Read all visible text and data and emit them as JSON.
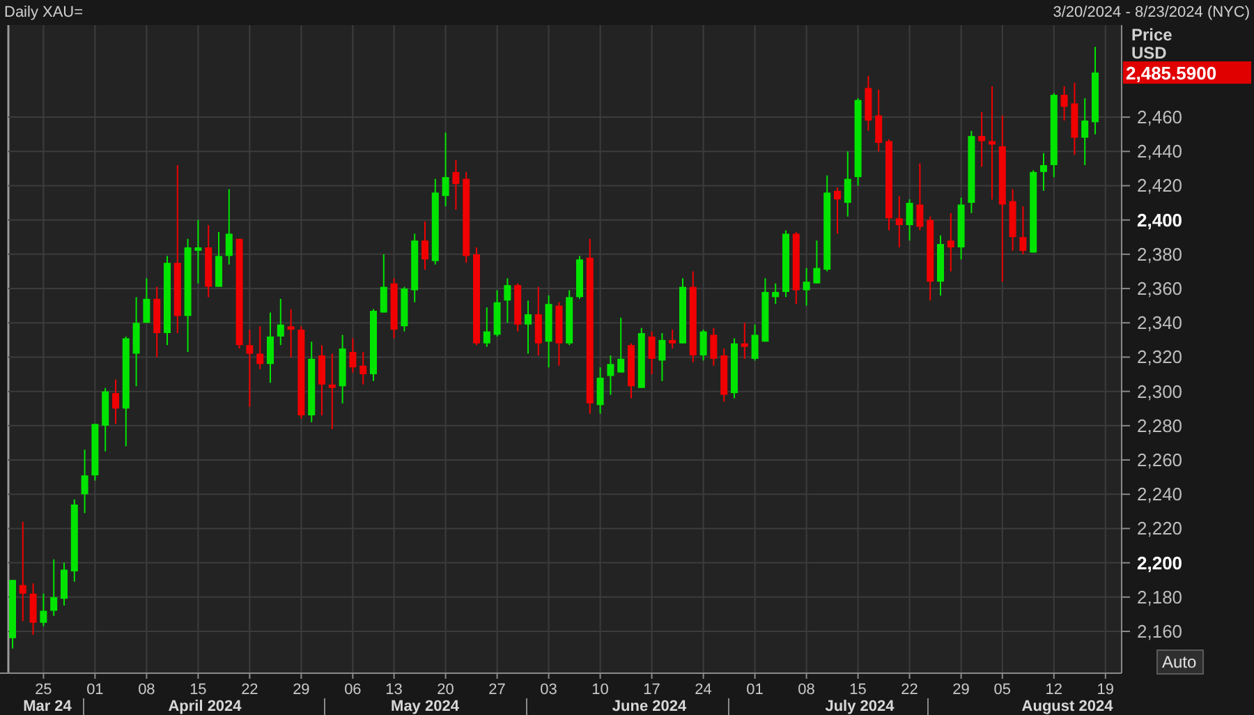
{
  "header": {
    "title": "Daily XAU=",
    "date_range": "3/20/2024 - 8/23/2024 (NYC)"
  },
  "price_axis": {
    "title": "Price",
    "currency": "USD",
    "last_price": "2,485.5900"
  },
  "scale_button": {
    "label": "Auto"
  },
  "chart": {
    "chart_data": {
      "type": "candlestick",
      "grid": true,
      "ylim": [
        2135.6,
        2513.7
      ],
      "categories": [
        null,
        null,
        null,
        "25",
        null,
        null,
        null,
        null,
        "01",
        null,
        null,
        null,
        null,
        "08",
        null,
        null,
        null,
        null,
        "15",
        null,
        null,
        null,
        null,
        "22",
        null,
        null,
        null,
        null,
        "29",
        null,
        null,
        null,
        null,
        "06",
        null,
        null,
        null,
        "13",
        null,
        null,
        null,
        null,
        "20",
        null,
        null,
        null,
        null,
        "27",
        null,
        null,
        null,
        null,
        "03",
        null,
        null,
        null,
        null,
        "10",
        null,
        null,
        null,
        null,
        "17",
        null,
        null,
        null,
        null,
        "24",
        null,
        null,
        null,
        null,
        "01",
        null,
        null,
        null,
        null,
        "08",
        null,
        null,
        null,
        null,
        "15",
        null,
        null,
        null,
        null,
        "22",
        null,
        null,
        null,
        null,
        "29",
        null,
        null,
        null,
        "05",
        null,
        null,
        null,
        null,
        "12",
        null,
        null,
        null,
        null,
        "19"
      ],
      "ohlc": [
        [
          2156,
          2190,
          2150,
          2190
        ],
        [
          2187,
          2224,
          2166,
          2182
        ],
        [
          2182,
          2188,
          2158,
          2165
        ],
        [
          2165,
          2182,
          2163,
          2172
        ],
        [
          2172,
          2202,
          2169,
          2180
        ],
        [
          2179,
          2200,
          2175,
          2196
        ],
        [
          2195,
          2237,
          2189,
          2234
        ],
        [
          2240,
          2266,
          2229,
          2251
        ],
        [
          2251,
          2281,
          2248,
          2281
        ],
        [
          2280,
          2302,
          2265,
          2300
        ],
        [
          2299,
          2307,
          2281,
          2290
        ],
        [
          2290,
          2332,
          2268,
          2331
        ],
        [
          2322,
          2355,
          2303,
          2340
        ],
        [
          2340,
          2366,
          2340,
          2354
        ],
        [
          2354,
          2361,
          2320,
          2334
        ],
        [
          2334,
          2379,
          2327,
          2375
        ],
        [
          2375,
          2432,
          2334,
          2344
        ],
        [
          2344,
          2389,
          2323,
          2384
        ],
        [
          2382,
          2400,
          2363,
          2384
        ],
        [
          2384,
          2397,
          2355,
          2361
        ],
        [
          2361,
          2393,
          2361,
          2379
        ],
        [
          2379,
          2418,
          2374,
          2392
        ],
        [
          2389,
          2389,
          2325,
          2327
        ],
        [
          2327,
          2336,
          2291,
          2322
        ],
        [
          2322,
          2338,
          2313,
          2316
        ],
        [
          2316,
          2346,
          2305,
          2332
        ],
        [
          2332,
          2354,
          2327,
          2339
        ],
        [
          2338,
          2348,
          2320,
          2336
        ],
        [
          2336,
          2338,
          2284,
          2286
        ],
        [
          2286,
          2329,
          2282,
          2319
        ],
        [
          2321,
          2327,
          2286,
          2304
        ],
        [
          2304,
          2322,
          2278,
          2302
        ],
        [
          2303,
          2333,
          2293,
          2325
        ],
        [
          2323,
          2331,
          2311,
          2314
        ],
        [
          2315,
          2323,
          2304,
          2310
        ],
        [
          2310,
          2348,
          2306,
          2347
        ],
        [
          2346,
          2380,
          2346,
          2361
        ],
        [
          2363,
          2366,
          2331,
          2336
        ],
        [
          2338,
          2361,
          2335,
          2360
        ],
        [
          2359,
          2392,
          2352,
          2388
        ],
        [
          2388,
          2399,
          2371,
          2377
        ],
        [
          2376,
          2424,
          2374,
          2416
        ],
        [
          2414,
          2451,
          2408,
          2425
        ],
        [
          2428,
          2435,
          2406,
          2421
        ],
        [
          2424,
          2428,
          2375,
          2379
        ],
        [
          2380,
          2384,
          2327,
          2328
        ],
        [
          2328,
          2349,
          2326,
          2335
        ],
        [
          2333,
          2359,
          2332,
          2352
        ],
        [
          2353,
          2366,
          2340,
          2362
        ],
        [
          2362,
          2363,
          2335,
          2339
        ],
        [
          2339,
          2353,
          2322,
          2345
        ],
        [
          2345,
          2361,
          2321,
          2328
        ],
        [
          2329,
          2356,
          2314,
          2351
        ],
        [
          2350,
          2352,
          2315,
          2328
        ],
        [
          2328,
          2359,
          2327,
          2355
        ],
        [
          2355,
          2379,
          2354,
          2377
        ],
        [
          2378,
          2389,
          2287,
          2293
        ],
        [
          2292,
          2314,
          2287,
          2308
        ],
        [
          2309,
          2321,
          2298,
          2316
        ],
        [
          2311,
          2343,
          2311,
          2319
        ],
        [
          2327,
          2328,
          2296,
          2303
        ],
        [
          2302,
          2337,
          2302,
          2334
        ],
        [
          2332,
          2335,
          2310,
          2319
        ],
        [
          2318,
          2334,
          2306,
          2330
        ],
        [
          2330,
          2336,
          2325,
          2328
        ],
        [
          2328,
          2366,
          2328,
          2361
        ],
        [
          2361,
          2370,
          2317,
          2321
        ],
        [
          2321,
          2336,
          2318,
          2335
        ],
        [
          2333,
          2337,
          2315,
          2319
        ],
        [
          2321,
          2325,
          2294,
          2298
        ],
        [
          2299,
          2331,
          2296,
          2328
        ],
        [
          2328,
          2340,
          2319,
          2326
        ],
        [
          2319,
          2339,
          2318,
          2333
        ],
        [
          2329,
          2366,
          2329,
          2358
        ],
        [
          2355,
          2363,
          2351,
          2358
        ],
        [
          2358,
          2394,
          2355,
          2392
        ],
        [
          2392,
          2393,
          2351,
          2359
        ],
        [
          2359,
          2372,
          2350,
          2364
        ],
        [
          2363,
          2388,
          2363,
          2372
        ],
        [
          2371,
          2426,
          2370,
          2416
        ],
        [
          2417,
          2419,
          2392,
          2412
        ],
        [
          2410,
          2440,
          2402,
          2424
        ],
        [
          2425,
          2471,
          2420,
          2470
        ],
        [
          2477,
          2484,
          2452,
          2458
        ],
        [
          2461,
          2476,
          2440,
          2445
        ],
        [
          2446,
          2447,
          2394,
          2401
        ],
        [
          2401,
          2414,
          2384,
          2397
        ],
        [
          2397,
          2412,
          2388,
          2410
        ],
        [
          2409,
          2433,
          2394,
          2396
        ],
        [
          2400,
          2402,
          2353,
          2364
        ],
        [
          2364,
          2391,
          2356,
          2386
        ],
        [
          2388,
          2404,
          2370,
          2384
        ],
        [
          2384,
          2413,
          2377,
          2409
        ],
        [
          2410,
          2452,
          2404,
          2449
        ],
        [
          2449,
          2463,
          2431,
          2446
        ],
        [
          2446,
          2478,
          2412,
          2444
        ],
        [
          2443,
          2461,
          2364,
          2409
        ],
        [
          2411,
          2418,
          2382,
          2390
        ],
        [
          2390,
          2408,
          2380,
          2382
        ],
        [
          2381,
          2429,
          2381,
          2428
        ],
        [
          2428,
          2439,
          2417,
          2432
        ],
        [
          2432,
          2474,
          2425,
          2473
        ],
        [
          2473,
          2478,
          2458,
          2466
        ],
        [
          2468,
          2480,
          2438,
          2448
        ],
        [
          2448,
          2471,
          2432,
          2458
        ],
        [
          2457,
          2501,
          2450,
          2486
        ],
        null
      ],
      "yticks": [
        {
          "value": 2160,
          "label": "2,160"
        },
        {
          "value": 2180,
          "label": "2,180"
        },
        {
          "value": 2200,
          "label": "2,200"
        },
        {
          "value": 2220,
          "label": "2,220"
        },
        {
          "value": 2240,
          "label": "2,240"
        },
        {
          "value": 2260,
          "label": "2,260"
        },
        {
          "value": 2280,
          "label": "2,280"
        },
        {
          "value": 2300,
          "label": "2,300"
        },
        {
          "value": 2320,
          "label": "2,320"
        },
        {
          "value": 2340,
          "label": "2,340"
        },
        {
          "value": 2360,
          "label": "2,360"
        },
        {
          "value": 2380,
          "label": "2,380"
        },
        {
          "value": 2400,
          "label": "2,400"
        },
        {
          "value": 2420,
          "label": "2,420"
        },
        {
          "value": 2440,
          "label": "2,440"
        },
        {
          "value": 2460,
          "label": "2,460"
        }
      ],
      "annotations": [
        "Mar 24",
        "April 2024",
        "May 2024",
        "June 2024",
        "July 2024",
        "August 2024"
      ]
    }
  }
}
